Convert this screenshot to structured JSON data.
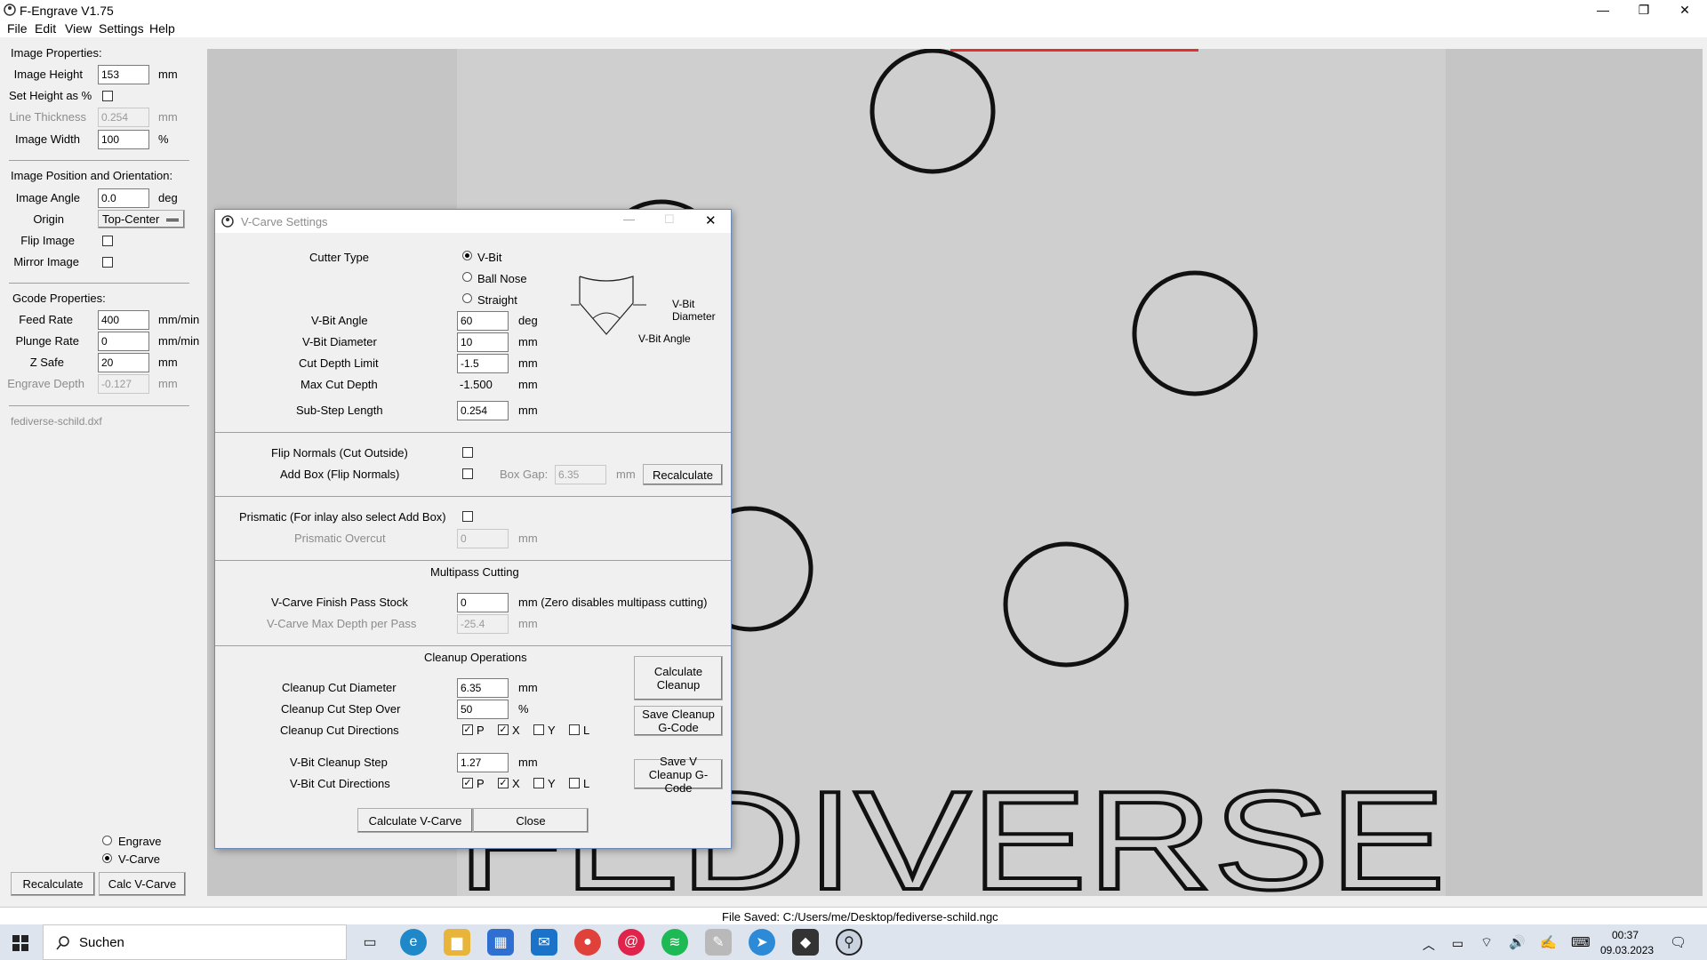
{
  "window": {
    "title": "F-Engrave V1.75",
    "minimize": "—",
    "restore": "❐",
    "close": "✕"
  },
  "menu": [
    "File",
    "Edit",
    "View",
    "Settings",
    "Help"
  ],
  "left": {
    "image_props_header": "Image Properties:",
    "image_height_label": "Image Height",
    "image_height_value": "153",
    "image_height_unit": "mm",
    "set_height_label": "Set Height as %",
    "line_thickness_label": "Line Thickness",
    "line_thickness_value": "0.254",
    "line_thickness_unit": "mm",
    "image_width_label": "Image Width",
    "image_width_value": "100",
    "image_width_unit": "%",
    "position_header": "Image Position and Orientation:",
    "image_angle_label": "Image Angle",
    "image_angle_value": "0.0",
    "image_angle_unit": "deg",
    "origin_label": "Origin",
    "origin_value": "Top-Center",
    "flip_label": "Flip Image",
    "mirror_label": "Mirror Image",
    "gcode_header": "Gcode Properties:",
    "feed_label": "Feed Rate",
    "feed_value": "400",
    "feed_unit": "mm/min",
    "plunge_label": "Plunge Rate",
    "plunge_value": "0",
    "plunge_unit": "mm/min",
    "zsafe_label": "Z Safe",
    "zsafe_value": "20",
    "zsafe_unit": "mm",
    "engrave_depth_label": "Engrave Depth",
    "engrave_depth_value": "-0.127",
    "engrave_depth_unit": "mm",
    "filename": "fediverse-schild.dxf",
    "mode_engrave": "Engrave",
    "mode_vcarve": "V-Carve",
    "recalculate_btn": "Recalculate",
    "calc_vcarve_btn": "Calc V-Carve"
  },
  "canvas": {
    "text": "FEDIVERSE"
  },
  "dialog": {
    "title": "V-Carve Settings",
    "cutter_type_label": "Cutter Type",
    "cutter_vbit": "V-Bit",
    "cutter_ballnose": "Ball Nose",
    "cutter_straight": "Straight",
    "diagram_diameter": "V-Bit\nDiameter",
    "diagram_angle": "V-Bit Angle",
    "vbit_angle_label": "V-Bit Angle",
    "vbit_angle_value": "60",
    "vbit_angle_unit": "deg",
    "vbit_diameter_label": "V-Bit Diameter",
    "vbit_diameter_value": "10",
    "vbit_diameter_unit": "mm",
    "cut_depth_limit_label": "Cut Depth Limit",
    "cut_depth_limit_value": "-1.5",
    "cut_depth_limit_unit": "mm",
    "max_cut_depth_label": "Max Cut Depth",
    "max_cut_depth_value": "-1.500",
    "max_cut_depth_unit": "mm",
    "substep_label": "Sub-Step Length",
    "substep_value": "0.254",
    "substep_unit": "mm",
    "flip_normals_label": "Flip Normals (Cut Outside)",
    "add_box_label": "Add Box (Flip Normals)",
    "box_gap_label": "Box Gap:",
    "box_gap_value": "6.35",
    "box_gap_unit": "mm",
    "recalculate_btn": "Recalculate",
    "prismatic_label": "Prismatic (For inlay also select Add Box)",
    "prismatic_overcut_label": "Prismatic Overcut",
    "prismatic_overcut_value": "0",
    "prismatic_overcut_unit": "mm",
    "multipass_header": "Multipass Cutting",
    "finish_stock_label": "V-Carve Finish Pass Stock",
    "finish_stock_value": "0",
    "finish_stock_unit": "mm (Zero disables multipass cutting)",
    "max_depth_pass_label": "V-Carve Max Depth per Pass",
    "max_depth_pass_value": "-25.4",
    "max_depth_pass_unit": "mm",
    "cleanup_header": "Cleanup Operations",
    "cleanup_diameter_label": "Cleanup Cut Diameter",
    "cleanup_diameter_value": "6.35",
    "cleanup_diameter_unit": "mm",
    "cleanup_stepover_label": "Cleanup Cut Step Over",
    "cleanup_stepover_value": "50",
    "cleanup_stepover_unit": "%",
    "cleanup_dirs_label": "Cleanup Cut Directions",
    "dir_p": "P",
    "dir_x": "X",
    "dir_y": "Y",
    "dir_l": "L",
    "vbit_cleanup_step_label": "V-Bit Cleanup Step",
    "vbit_cleanup_step_value": "1.27",
    "vbit_cleanup_step_unit": "mm",
    "vbit_dirs_label": "V-Bit Cut Directions",
    "calc_cleanup_btn": "Calculate Cleanup",
    "save_cleanup_btn": "Save Cleanup G-Code",
    "save_v_cleanup_btn": "Save V Cleanup G-Code",
    "calculate_vcarve_btn": "Calculate V-Carve",
    "close_btn": "Close"
  },
  "status": {
    "text": "File Saved: C:/Users/me/Desktop/fediverse-schild.ngc"
  },
  "taskbar": {
    "search": "Suchen",
    "time": "00:37",
    "date": "09.03.2023"
  }
}
